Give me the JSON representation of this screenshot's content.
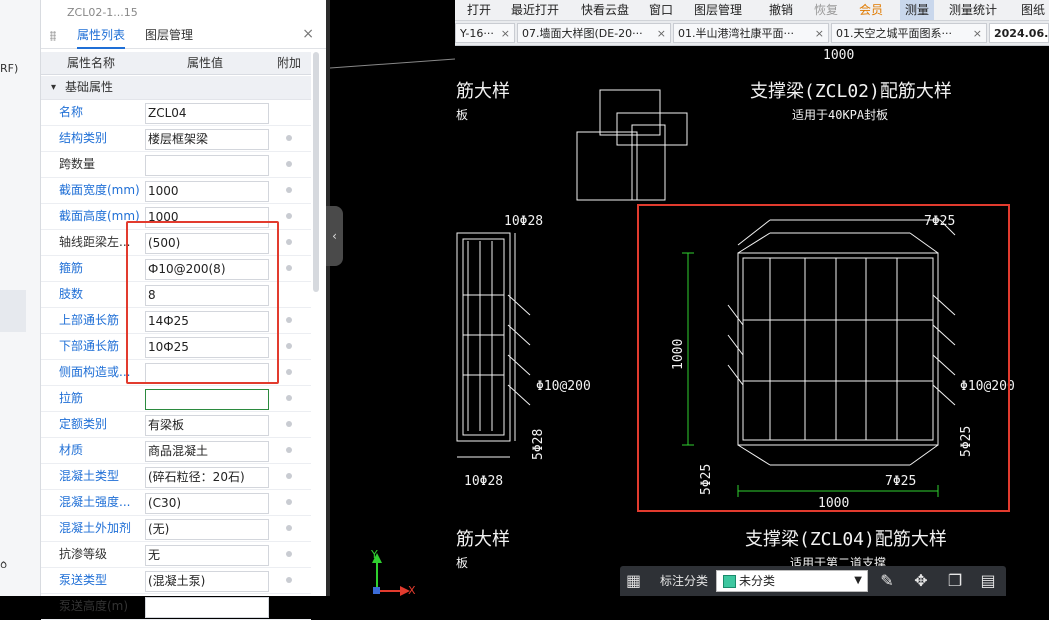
{
  "left_strip": {
    "labels": [
      "RF)",
      "ᰓ"
    ]
  },
  "panel": {
    "top_label": "ZCL02-1...15",
    "tabs": [
      {
        "label": "属性列表"
      },
      {
        "label": "图层管理"
      }
    ],
    "close": "×",
    "headers": {
      "name": "属性名称",
      "value": "属性值",
      "extra": "附加"
    },
    "group": {
      "expander": "▾",
      "label": "基础属性"
    },
    "rows": [
      {
        "name": "名称",
        "value": "ZCL04"
      },
      {
        "name": "结构类别",
        "value": "楼层框架梁"
      },
      {
        "name": "跨数量",
        "value": ""
      },
      {
        "name": "截面宽度(mm)",
        "value": "1000"
      },
      {
        "name": "截面高度(mm)",
        "value": "1000"
      },
      {
        "name": "轴线距梁左...",
        "value": "(500)"
      },
      {
        "name": "箍筋",
        "value": "Ф10@200(8)"
      },
      {
        "name": "肢数",
        "value": "8"
      },
      {
        "name": "上部通长筋",
        "value": "14Ф25"
      },
      {
        "name": "下部通长筋",
        "value": "10Ф25"
      },
      {
        "name": "侧面构造或...",
        "value": ""
      },
      {
        "name": "拉筋",
        "value": ""
      },
      {
        "name": "定额类别",
        "value": "有梁板"
      },
      {
        "name": "材质",
        "value": "商品混凝土"
      },
      {
        "name": "混凝土类型",
        "value": "(碎石粒径：20石)"
      },
      {
        "name": "混凝土强度...",
        "value": "(C30)"
      },
      {
        "name": "混凝土外加剂",
        "value": "(无)"
      },
      {
        "name": "抗渗等级",
        "value": "无"
      },
      {
        "name": "泵送类型",
        "value": "(混凝土泵)"
      },
      {
        "name": "泵送高度(m)",
        "value": ""
      }
    ]
  },
  "menubar": {
    "items": [
      "打开",
      "最近打开",
      "快看云盘",
      "窗口",
      "图层管理",
      "撤销",
      "恢复",
      "会员",
      "测量",
      "测量统计",
      "图纸"
    ]
  },
  "doc_tabs": [
    {
      "label": "Y-16···"
    },
    {
      "label": "07.墙面大样图(DE-20···"
    },
    {
      "label": "01.半山港湾社康平面···"
    },
    {
      "label": "01.天空之城平面图系···"
    },
    {
      "label": "2024.06."
    }
  ],
  "cad": {
    "dim_top": "1000",
    "left_title": "筋大样",
    "left_sub": "板",
    "right_title": "支撑梁(ZCL02)配筋大样",
    "right_sub": "适用于40KPA封板",
    "lbl_10f28_top": "10Φ28",
    "lbl_10f28_bottom": "10Φ28",
    "lbl_left_stirrup": "Φ10@200",
    "lbl_left_side": "5Φ28",
    "lbl_7f25_top": "7Φ25",
    "lbl_7f25_bottom": "7Φ25",
    "lbl_right_stirrup": "Φ10@200",
    "lbl_dim_vert": "1000",
    "lbl_dim_horiz": "1000",
    "lbl_5f25_left": "5Φ25",
    "lbl_5f25_right": "5Φ25",
    "bottom_left_title": "筋大样",
    "bottom_left_sub": "板",
    "bottom_title": "支撑梁(ZCL04)配筋大样",
    "bottom_sub": "适用于第二道支撑",
    "axis_y": "Y",
    "axis_x": "X"
  },
  "statusbar": {
    "label": "标注分类",
    "select_value": "未分类",
    "caret": "▼",
    "icons": [
      "grid-icon",
      "edit-icon",
      "move-icon",
      "copy-icon",
      "paste-icon"
    ],
    "glyphs": [
      "▦",
      "✎",
      "✥",
      "❐",
      "▤"
    ]
  },
  "colors": {
    "accent": "#1f6fd6",
    "highlight": "#e23b2e",
    "cad_white": "#f2f2f2",
    "cad_green": "#2fd02f",
    "swatch": "#3ec7a0"
  }
}
